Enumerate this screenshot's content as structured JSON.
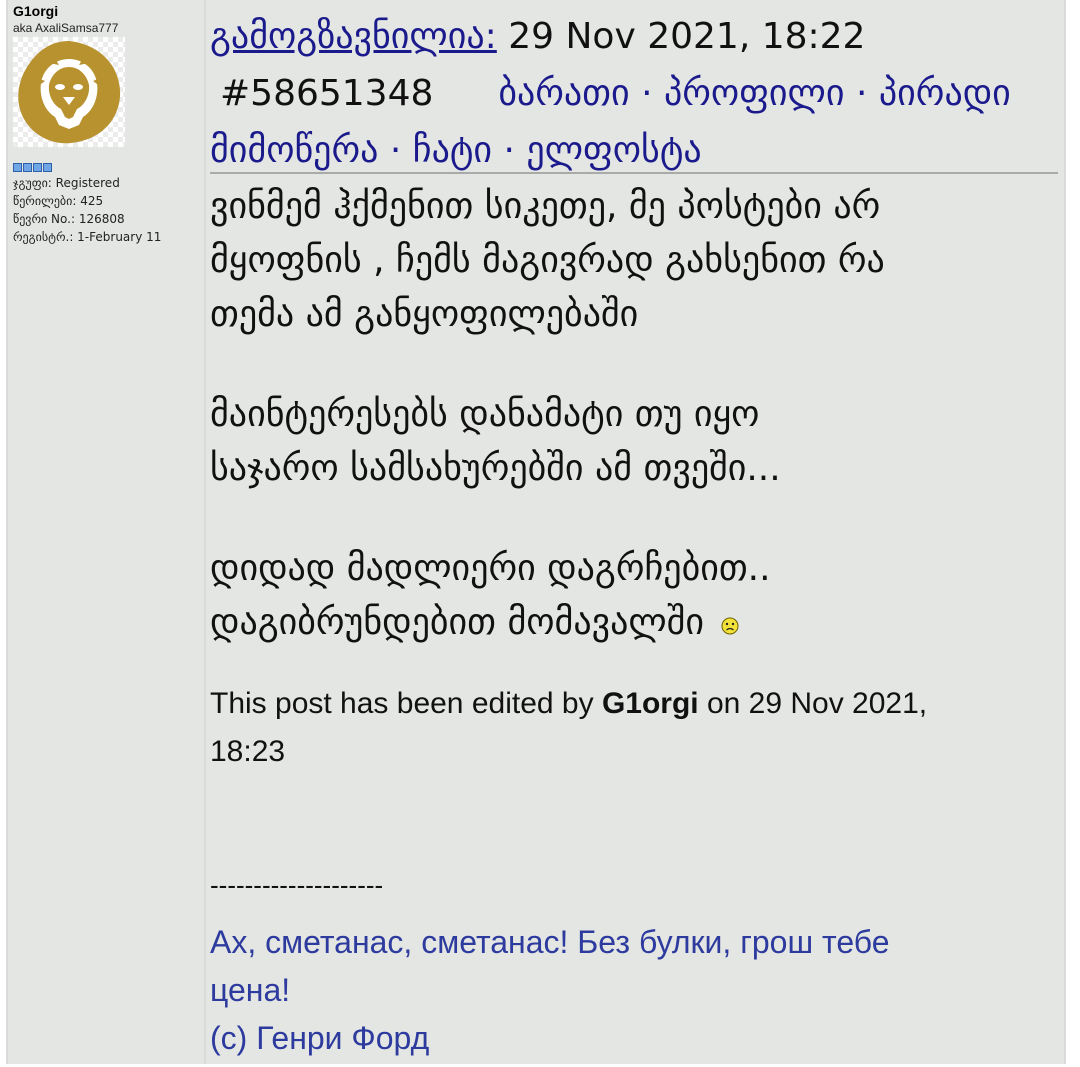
{
  "author": {
    "username": "G1orgi",
    "aka": "aka AxaliSamsa777",
    "avatar_icon": "lion-icon",
    "rank_pips": 4,
    "group_label": "ჯგუფი: Registered",
    "posts_label": "წერილები: 425",
    "member_no_label": "წევრი No.: 126808",
    "registered_label": "რეგისტრ.: 1-February 11"
  },
  "post_header": {
    "sent_label": "გამოგზავნილია:",
    "date": "29 Nov 2021, 18:22",
    "post_id": "#58651348",
    "links": {
      "card": "ბარათი",
      "profile": "პროფილი",
      "private_1": "პირადი",
      "private_2": "მიმოწერა",
      "chat": "ჩატი",
      "email": "ელფოსტა"
    },
    "separator": "·"
  },
  "post_body": {
    "p1_line1": "ვინმემ ჰქმენით სიკეთე, მე პოსტები არ",
    "p1_line2": "მყოფნის , ჩემს მაგივრად გახსენით რა",
    "p1_line3": "თემა ამ განყოფილებაში",
    "p2_line1": "მაინტერესებს დანამატი თუ იყო",
    "p2_line2": "საჯარო სამსახურებში ამ თვეში...",
    "p3_line1": "დიდად მადლიერი დაგრჩებით..",
    "p3_line2": "დაგიბრუნდებით მომავალში",
    "smiley_icon": "sad-smiley-icon"
  },
  "edit_note": {
    "prefix": "This post has been edited by",
    "editor": "G1orgi",
    "middle": "on 29 Nov 2021,",
    "time": "18:23"
  },
  "signature": {
    "separator": "--------------------",
    "line1": "Ах, сметанас, сметанас! Без булки, грош тебе",
    "line2": "цена!",
    "line3": "(с) Генри Форд"
  },
  "colors": {
    "link": "#1a1a8c",
    "signature": "#2d3a9e",
    "panel": "#e4e6e3"
  }
}
